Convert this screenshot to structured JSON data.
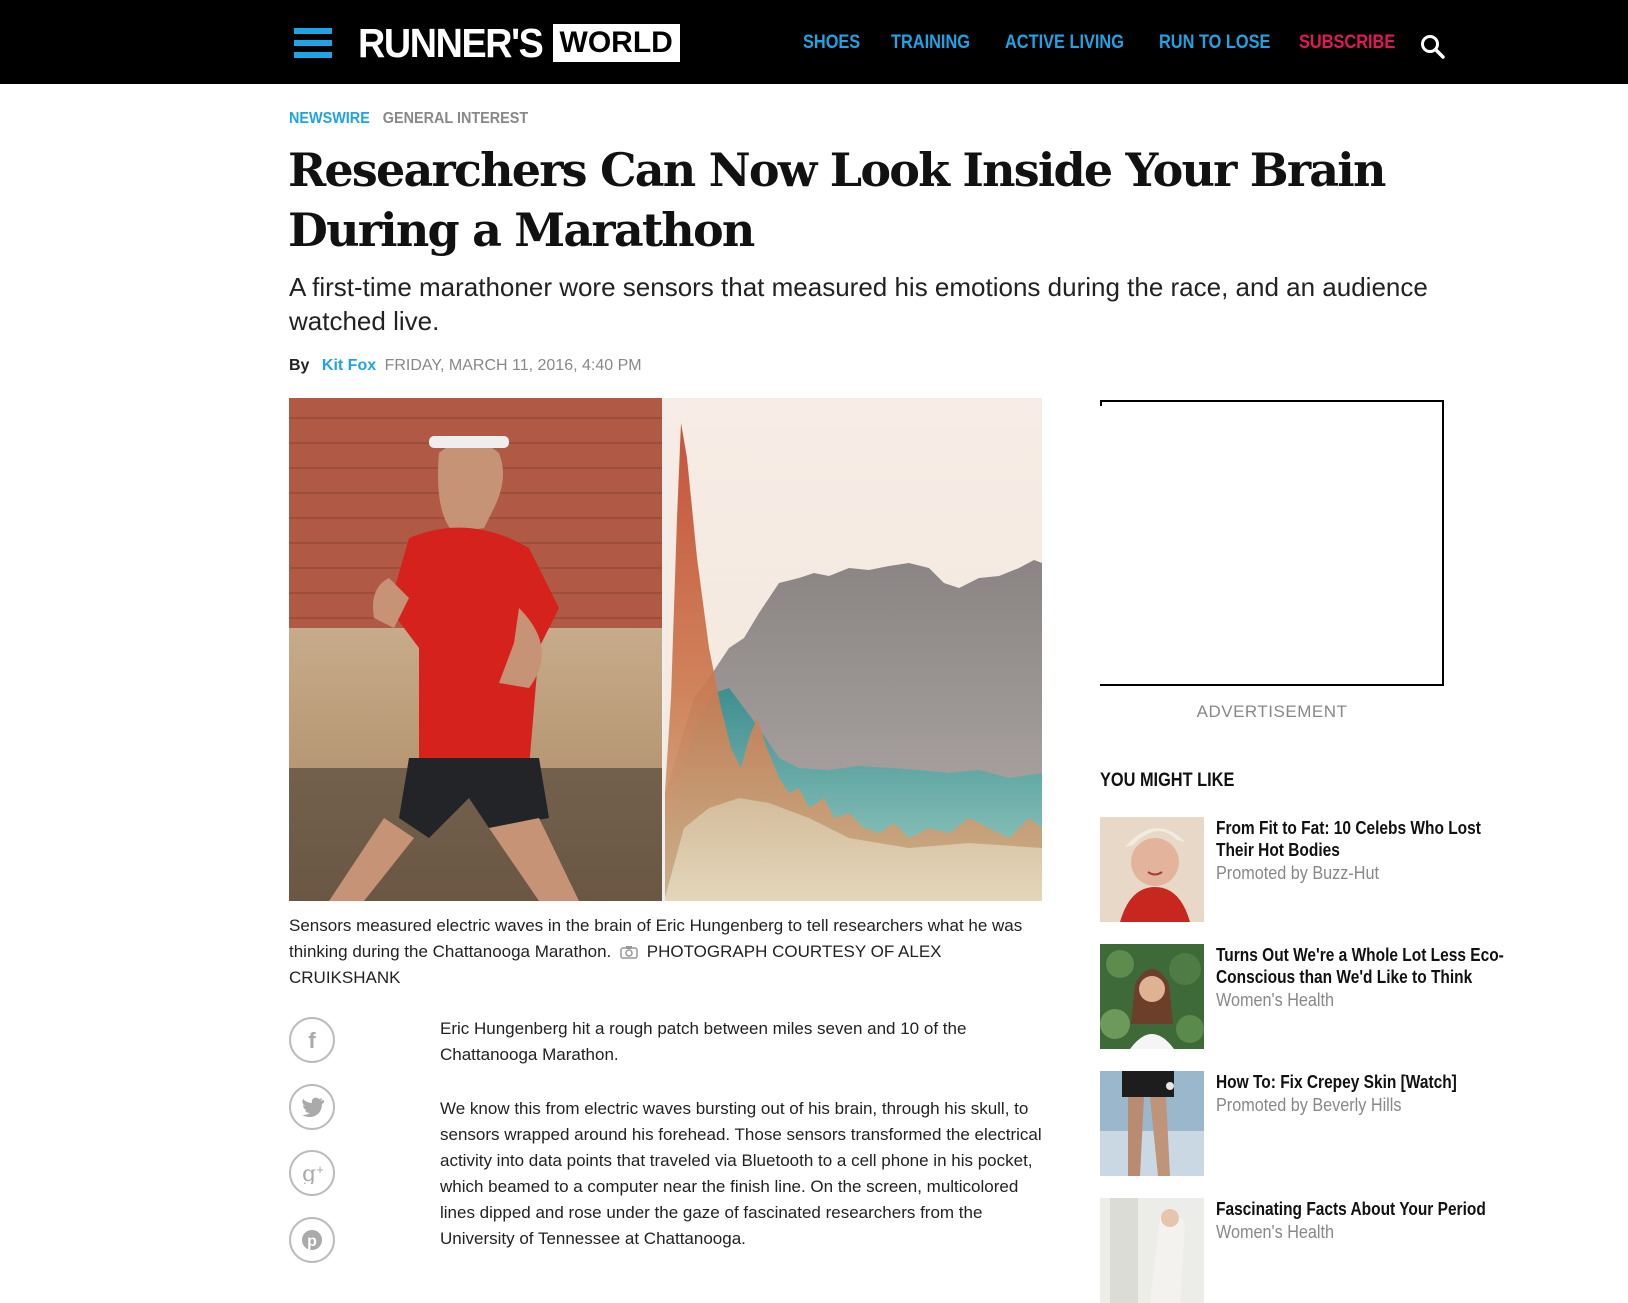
{
  "header": {
    "logo_main": "RUNNER'S",
    "logo_box": "WORLD",
    "nav": [
      "SHOES",
      "TRAINING",
      "ACTIVE LIVING",
      "RUN TO LOSE",
      "SUBSCRIBE"
    ]
  },
  "breadcrumbs": [
    "NEWSWIRE",
    "GENERAL INTEREST"
  ],
  "article": {
    "title": "Researchers Can Now Look Inside Your Brain During a Marathon",
    "dek": "A first-time marathoner wore sensors that measured his emotions during the race, and an audience watched live.",
    "by_label": "By",
    "author": "Kit Fox",
    "date": "FRIDAY, MARCH 11, 2016, 4:40 PM",
    "caption": "Sensors measured electric waves in the brain of Eric Hungenberg to tell researchers what he was thinking during the Chattanooga Marathon.",
    "credit": "PHOTOGRAPH COURTESY OF ALEX CRUIKSHANK",
    "paragraphs": [
      "Eric Hungenberg hit a rough patch between miles seven and 10 of the Chattanooga Marathon.",
      "We know this from electric waves bursting out of his brain, through his skull, to sensors wrapped around his forehead. Those sensors transformed the electrical activity into data points that traveled via Bluetooth to a cell phone in his pocket, which beamed to a computer near the finish line. On the screen, multicolored lines dipped and rose under the gaze of fascinated researchers from the University of Tennessee at Chattanooga."
    ]
  },
  "share_icons": [
    "facebook-icon",
    "twitter-icon",
    "google-plus-icon",
    "pinterest-icon"
  ],
  "sidebar": {
    "ad_label": "ADVERTISEMENT",
    "heading": "YOU MIGHT LIKE",
    "items": [
      {
        "title": "From Fit to Fat: 10 Celebs Who Lost Their Hot Bodies",
        "source": "Promoted by Buzz-Hut"
      },
      {
        "title": "Turns Out We're a Whole Lot Less Eco-Conscious than We'd Like to Think",
        "source": "Women's Health"
      },
      {
        "title": "How To: Fix Crepey Skin [Watch]",
        "source": "Promoted by Beverly Hills"
      },
      {
        "title": "Fascinating Facts About Your Period",
        "source": "Women's Health"
      }
    ]
  },
  "colors": {
    "accent_blue": "#1ea3e4",
    "subscribe_pink": "#e2185a",
    "header_bg": "#000000"
  }
}
